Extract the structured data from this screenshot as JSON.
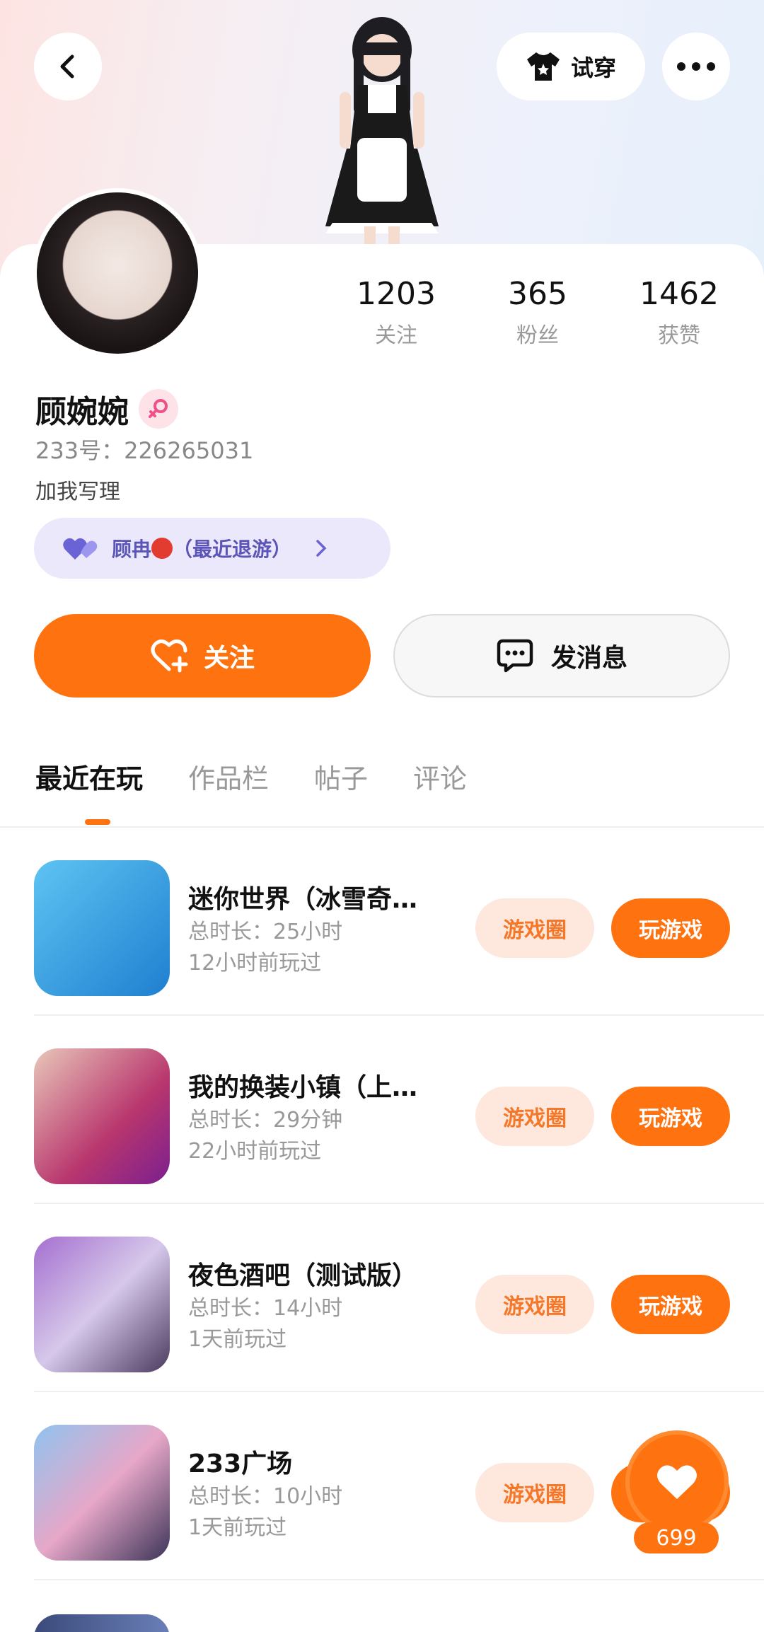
{
  "header": {
    "try_on_label": "试穿"
  },
  "profile": {
    "stats": [
      {
        "value": "1203",
        "label": "关注"
      },
      {
        "value": "365",
        "label": "粉丝"
      },
      {
        "value": "1462",
        "label": "获赞"
      }
    ],
    "name": "顾婉婉",
    "uid": "233号：226265031",
    "bio": "加我写理",
    "friend_pill": {
      "name": "顾冉",
      "status": "（最近退游）"
    }
  },
  "actions": {
    "follow_label": "关注",
    "message_label": "发消息"
  },
  "tabs": [
    "最近在玩",
    "作品栏",
    "帖子",
    "评论"
  ],
  "games": [
    {
      "title": "迷你世界（冰雪奇…",
      "duration": "总时长：25小时",
      "last_played": "12小时前玩过",
      "circle_label": "游戏圈",
      "play_label": "玩游戏",
      "icon_color": "#39a7e8"
    },
    {
      "title": "我的换装小镇（上…",
      "duration": "总时长：29分钟",
      "last_played": "22小时前玩过",
      "circle_label": "游戏圈",
      "play_label": "玩游戏",
      "icon_color": "#c2428a"
    },
    {
      "title": "夜色酒吧（测试版）",
      "duration": "总时长：14小时",
      "last_played": "1天前玩过",
      "circle_label": "游戏圈",
      "play_label": "玩游戏",
      "icon_color": "#8a5fb4"
    },
    {
      "title": "233广场",
      "duration": "总时长：10小时",
      "last_played": "1天前玩过",
      "circle_label": "游戏圈",
      "play_label": "玩游戏",
      "icon_color": "#5b8fd6"
    }
  ],
  "like_fab": {
    "count": "699"
  },
  "colors": {
    "accent": "#ff7210",
    "accent_light": "#fee7dc",
    "friend_pill_bg": "#ebe8fb",
    "friend_pill_text": "#5b55b8"
  }
}
